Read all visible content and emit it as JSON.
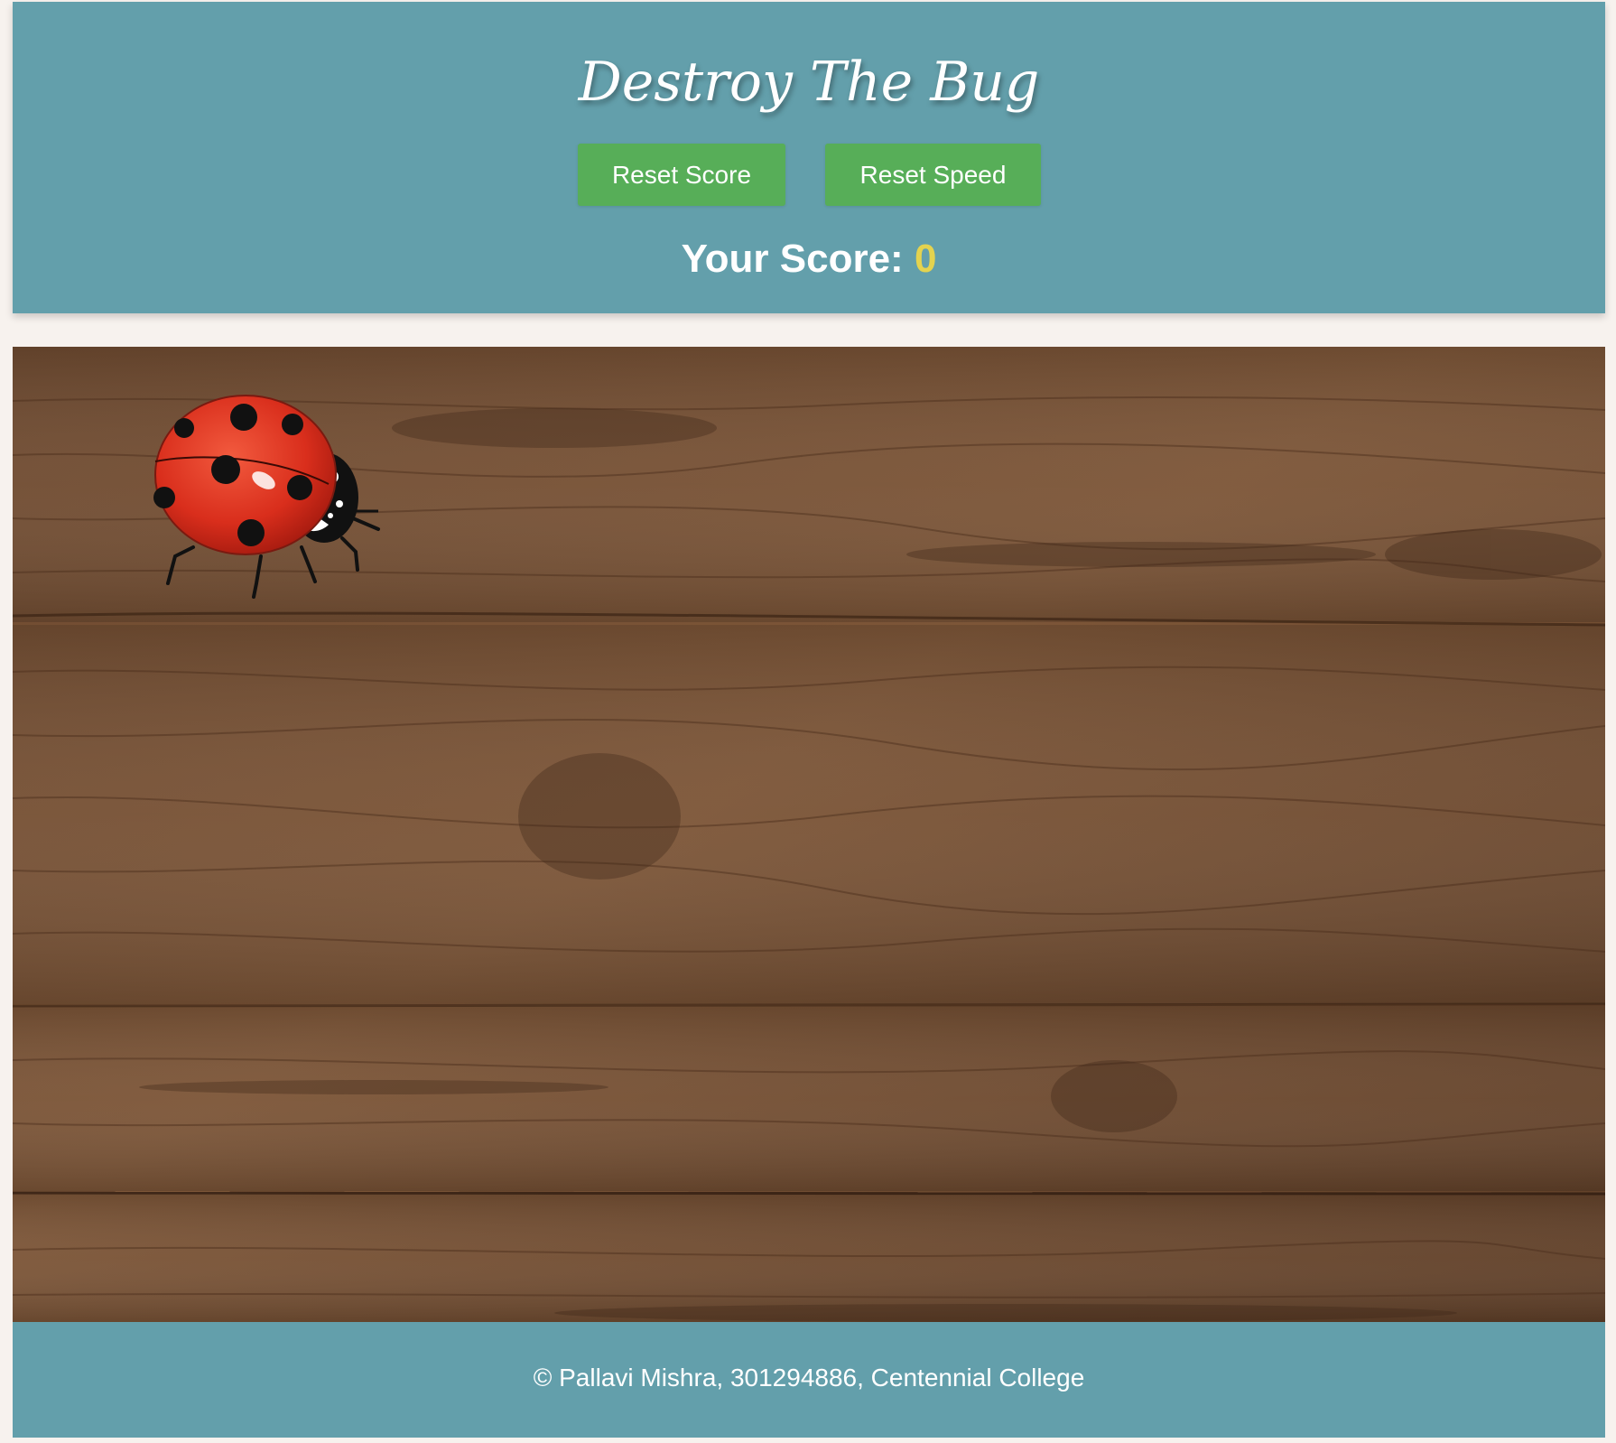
{
  "header": {
    "title": "Destroy The Bug",
    "reset_score_label": "Reset Score",
    "reset_speed_label": "Reset Speed",
    "score_label": "Your Score:",
    "score_value": "0"
  },
  "board": {
    "background": "wood-planks-texture",
    "bug_icon": "ladybug-icon"
  },
  "footer": {
    "text": "© Pallavi Mishra, 301294886, Centennial College"
  },
  "colors": {
    "header_bg": "#639fab",
    "button_bg": "#57ae58",
    "score_accent": "#e4d34f",
    "page_bg": "#f7f2ee"
  }
}
